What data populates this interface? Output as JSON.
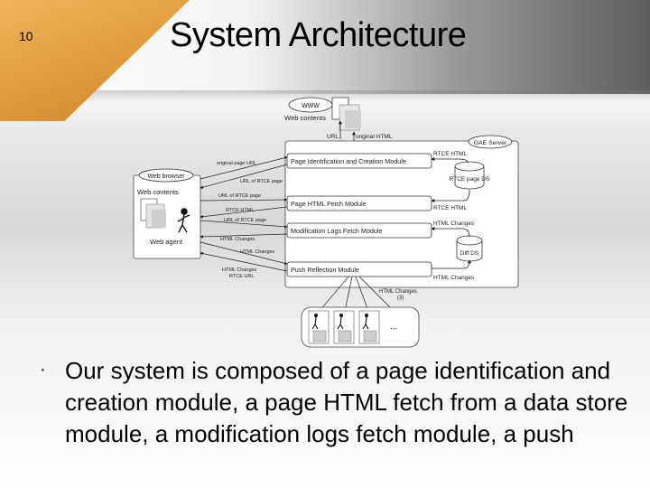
{
  "slide": {
    "number": "10",
    "title": "System Architecture",
    "bullet": "Our system is composed of a page identification and creation module, a page HTML fetch from a data store module, a modification logs fetch module, a push"
  },
  "diagram": {
    "www_label": "WWW",
    "web_contents_top": "Web contents",
    "url_label": "URL",
    "original_html_label": "original HTML",
    "gae_server_label": "GAE Server",
    "rtce_html_top": "RTCE HTML",
    "rtce_page_ds": "RTCE page DS",
    "rtce_html_mid": "RTCE HTML",
    "html_changes_1": "HTML Changes",
    "diff_ds": "Diff DS",
    "html_changes_2": "HTML Changes",
    "web_browser_label": "Web browser",
    "web_contents_left": "Web contents",
    "web_agent_label": "Web agent",
    "module_1": "Page Identification and Creation Module",
    "module_2": "Page HTML Fetch Module",
    "module_3": "Modification Logs Fetch Module",
    "module_4": "Push Reflection Module",
    "arrow_original_page_url": "original page URL",
    "arrow_url_rtce_page": "URL of RTCE page",
    "arrow_url_of_rtce_page_1": "URL of RTCE page",
    "arrow_rtce_html": "RTCE HTML",
    "arrow_url_of_rtce_page_2": "URL of RTCE page",
    "arrow_html_changes_1": "HTML Changes",
    "arrow_html_changes_2": "HTML Changes",
    "arrow_html_changes_3": "HTML Changes",
    "arrow_rtce_url": "RTCE URL",
    "push_html_changes": "HTML Changes",
    "push_count": "(3)",
    "ellipsis": "..."
  }
}
